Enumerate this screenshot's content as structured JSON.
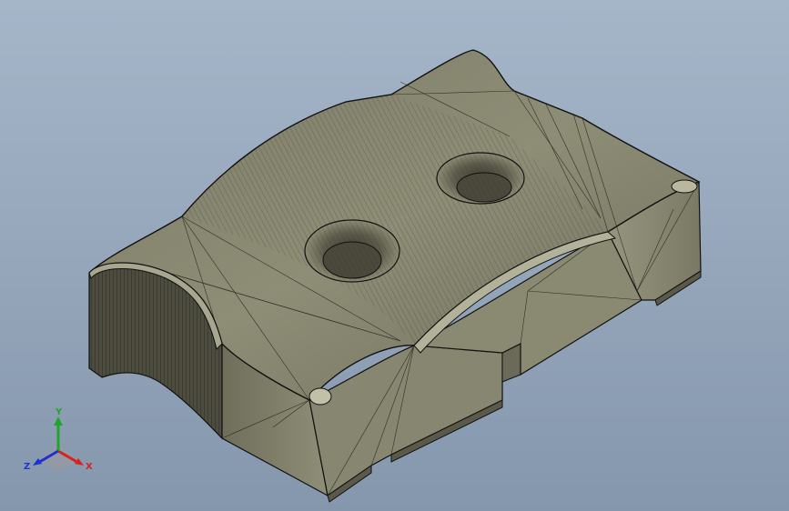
{
  "viewport": {
    "background_top": "#a6b6c9",
    "background_bottom": "#8597ad"
  },
  "model": {
    "face_color": "#8b8a73",
    "face_light": "#a3a28a",
    "face_dark": "#5f5e4c",
    "edge_color": "#111111"
  },
  "triad": {
    "x_label": "X",
    "y_label": "Y",
    "z_label": "Z",
    "x_color": "#d92020",
    "y_color": "#1fa52a",
    "z_color": "#2030d8"
  }
}
